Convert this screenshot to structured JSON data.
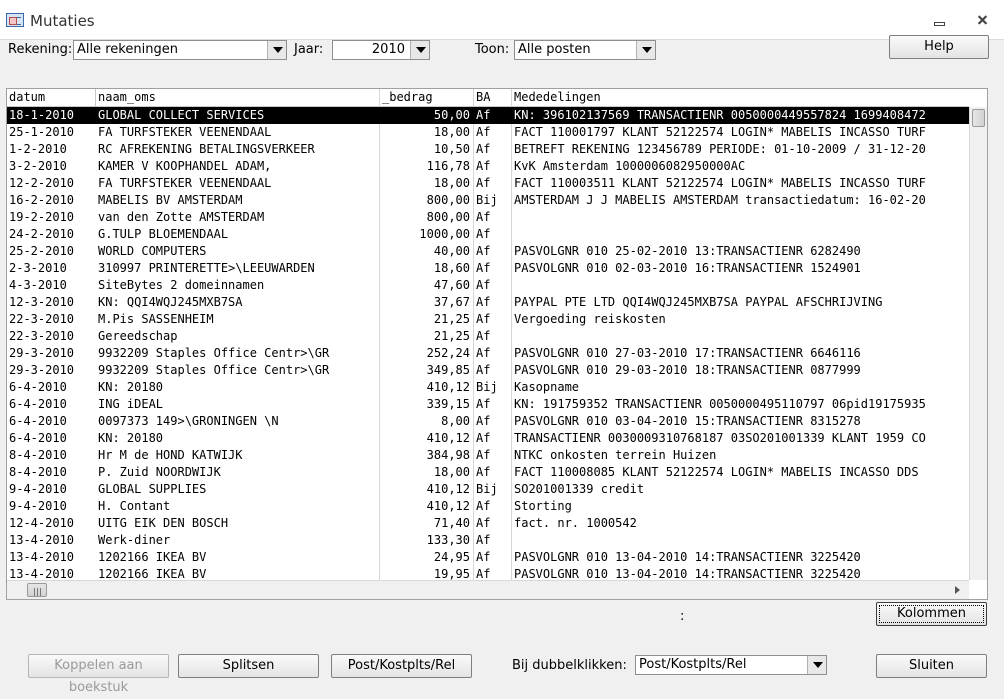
{
  "window": {
    "title": "Mutaties",
    "minimize_icon": "minimize-icon",
    "close_icon": "close-icon"
  },
  "filters": {
    "rekening_label": "Rekening:",
    "rekening_value": "Alle rekeningen",
    "jaar_label": "Jaar:",
    "jaar_value": "2010",
    "toon_label": "Toon:",
    "toon_value": "Alle posten"
  },
  "buttons": {
    "help": "Help",
    "kolommen": "Kolommen",
    "koppelen": "Koppelen aan boekstuk",
    "splitsen": "Splitsen",
    "post": "Post/Kostplts/Rel",
    "sluiten": "Sluiten"
  },
  "footer": {
    "status_colon": ":",
    "dubbelklik_label": "Bij dubbelklikken:",
    "dubbelklik_value": "Post/Kostplts/Rel"
  },
  "table": {
    "columns": [
      "datum",
      "naam_oms",
      "_bedrag",
      "BA",
      "Mededelingen"
    ],
    "rows": [
      [
        "18-1-2010",
        "GLOBAL COLLECT SERVICES",
        "50,00",
        "Af",
        "KN: 396102137569 TRANSACTIENR 0050000449557824 1699408472"
      ],
      [
        "25-1-2010",
        "FA TURFSTEKER VEENENDAAL",
        "18,00",
        "Af",
        "FACT 110001797 KLANT 52122574 LOGIN* MABELIS INCASSO TURF"
      ],
      [
        "1-2-2010",
        "RC AFREKENING BETALINGSVERKEER",
        "10,50",
        "Af",
        "BETREFT REKENING 123456789 PERIODE: 01-10-2009 / 31-12-20"
      ],
      [
        "3-2-2010",
        "KAMER V KOOPHANDEL ADAM,",
        "116,78",
        "Af",
        "KvK Amsterdam 1000006082950000AC"
      ],
      [
        "12-2-2010",
        "FA TURFSTEKER VEENENDAAL",
        "18,00",
        "Af",
        "FACT 110003511 KLANT 52122574 LOGIN* MABELIS INCASSO TURF"
      ],
      [
        "16-2-2010",
        "MABELIS BV AMSTERDAM",
        "800,00",
        "Bij",
        "AMSTERDAM J J MABELIS AMSTERDAM transactiedatum: 16-02-20"
      ],
      [
        "19-2-2010",
        "van den Zotte AMSTERDAM",
        "800,00",
        "Af",
        ""
      ],
      [
        "24-2-2010",
        "G.TULP BLOEMENDAAL",
        "1000,00",
        "Af",
        ""
      ],
      [
        "25-2-2010",
        "WORLD COMPUTERS",
        "40,00",
        "Af",
        "PASVOLGNR 010 25-02-2010 13:TRANSACTIENR 6282490"
      ],
      [
        "2-3-2010",
        "310997  PRINTERETTE>\\LEEUWARDEN",
        "18,60",
        "Af",
        "PASVOLGNR 010 02-03-2010 16:TRANSACTIENR 1524901"
      ],
      [
        "4-3-2010",
        "SiteBytes 2 domeinnamen",
        "47,60",
        "Af",
        ""
      ],
      [
        "12-3-2010",
        "KN: QQI4WQJ245MXB7SA",
        "37,67",
        "Af",
        "PAYPAL PTE LTD QQI4WQJ245MXB7SA PAYPAL AFSCHRIJVING"
      ],
      [
        "22-3-2010",
        "M.Pis SASSENHEIM",
        "21,25",
        "Af",
        "Vergoeding reiskosten"
      ],
      [
        "22-3-2010",
        "Gereedschap",
        "21,25",
        "Af",
        ""
      ],
      [
        "29-3-2010",
        "9932209 Staples Office Centr>\\GR",
        "252,24",
        "Af",
        "PASVOLGNR 010 27-03-2010 17:TRANSACTIENR 6646116"
      ],
      [
        "29-3-2010",
        "9932209 Staples Office Centr>\\GR",
        "349,85",
        "Af",
        "PASVOLGNR 010 29-03-2010 18:TRANSACTIENR 0877999"
      ],
      [
        "6-4-2010",
        "KN: 20180",
        "410,12",
        "Bij",
        "Kasopname"
      ],
      [
        "6-4-2010",
        "ING iDEAL",
        "339,15",
        "Af",
        "KN: 191759352 TRANSACTIENR 0050000495110797 06pid19175935"
      ],
      [
        "6-4-2010",
        "0097373 149>\\GRONINGEN \\N",
        "8,00",
        "Af",
        "PASVOLGNR 010 03-04-2010 15:TRANSACTIENR 8315278"
      ],
      [
        "6-4-2010",
        "KN: 20180",
        "410,12",
        "Af",
        "TRANSACTIENR 0030009310768187 03SO201001339 KLANT 1959 CO"
      ],
      [
        "8-4-2010",
        "Hr M de HOND KATWIJK",
        "384,98",
        "Af",
        "NTKC onkosten terrein Huizen"
      ],
      [
        "8-4-2010",
        "P. Zuid NOORDWIJK",
        "18,00",
        "Af",
        "FACT 110008085 KLANT 52122574 LOGIN* MABELIS INCASSO DDS"
      ],
      [
        "9-4-2010",
        "GLOBAL SUPPLIES",
        "410,12",
        "Bij",
        "SO201001339 credit"
      ],
      [
        "9-4-2010",
        "H. Contant",
        "410,12",
        "Af",
        "Storting"
      ],
      [
        "12-4-2010",
        "UITG EIK DEN BOSCH",
        "71,40",
        "Af",
        "fact. nr. 1000542"
      ],
      [
        "13-4-2010",
        "Werk-diner",
        "133,30",
        "Af",
        ""
      ],
      [
        "13-4-2010",
        "1202166 IKEA BV",
        "24,95",
        "Af",
        "PASVOLGNR 010 13-04-2010 14:TRANSACTIENR 3225420"
      ],
      [
        "13-4-2010",
        "1202166 IKEA BV",
        "19,95",
        "Af",
        "PASVOLGNR 010 13-04-2010 14:TRANSACTIENR 3225420"
      ]
    ],
    "selected_row": 0
  }
}
